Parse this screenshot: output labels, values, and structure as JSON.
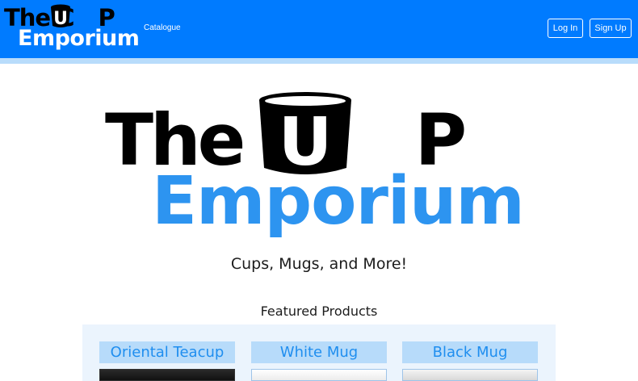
{
  "header": {
    "brand_line1_left": "The C",
    "brand_line1_right": "P",
    "brand_cup_letter": "U",
    "brand_line2": "Emporium",
    "nav_links": [
      {
        "label": "Catalogue"
      }
    ],
    "login_label": "Log In",
    "signup_label": "Sign Up"
  },
  "hero": {
    "line1_left": "The C",
    "line1_right": "P",
    "cup_letter": "U",
    "line2": "Emporium",
    "tagline": "Cups, Mugs, and More!"
  },
  "featured": {
    "title": "Featured Products",
    "products": [
      {
        "name": "Oriental Teacup"
      },
      {
        "name": "White Mug"
      },
      {
        "name": "Black Mug"
      }
    ]
  },
  "colors": {
    "navbar": "#007bff",
    "accent_blue": "#2d94f0",
    "card_header": "#b7dbfa",
    "panel": "#ebf4fd"
  }
}
